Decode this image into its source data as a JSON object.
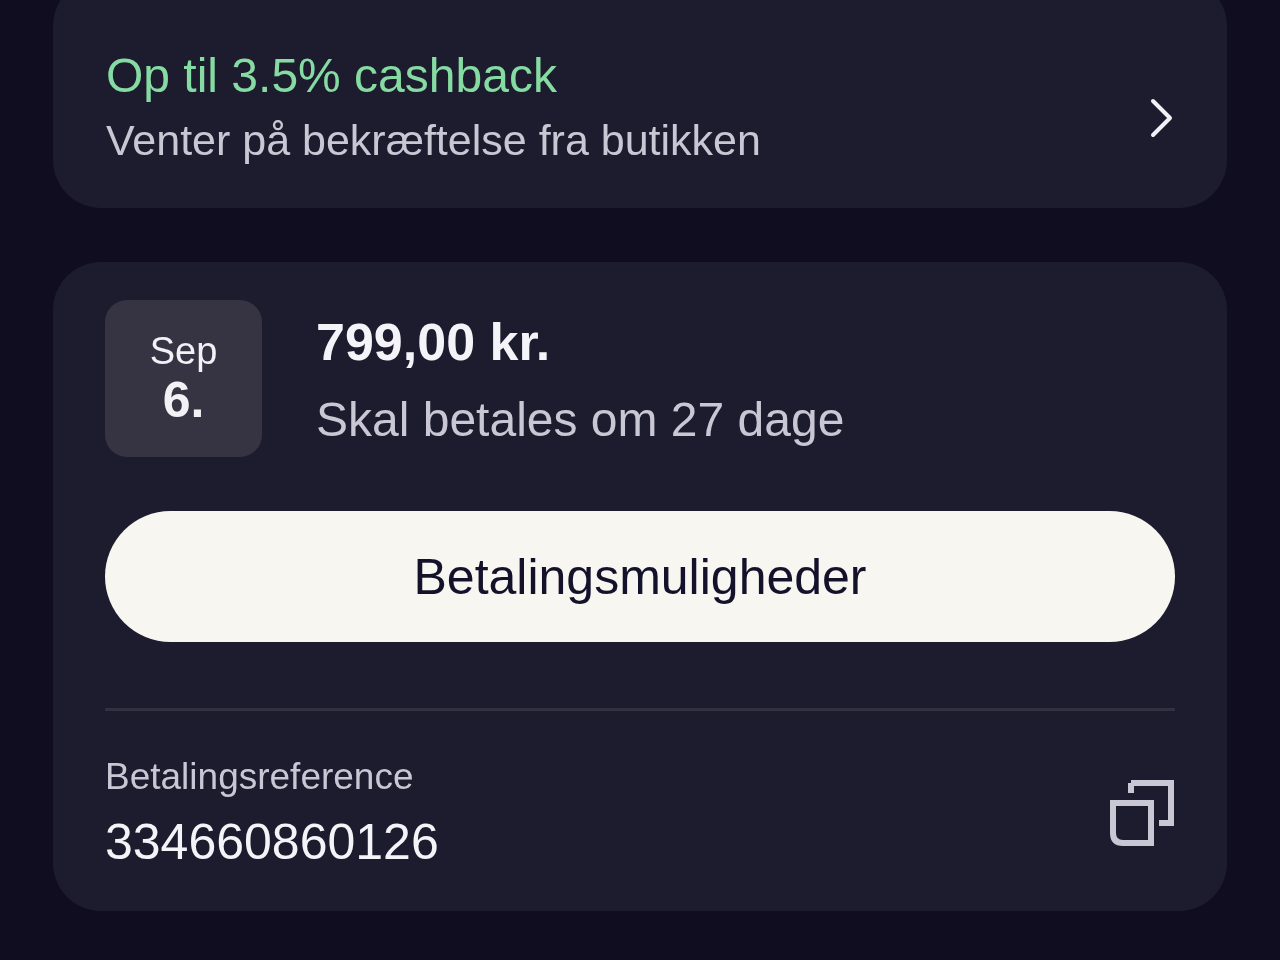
{
  "cashback": {
    "title": "Op til 3.5% cashback",
    "subtitle": "Venter på bekræftelse fra butikken"
  },
  "payment": {
    "month": "Sep",
    "day": "6.",
    "amount": "799,00 kr.",
    "due": "Skal betales om 27 dage",
    "button": "Betalingsmuligheder",
    "reference_label": "Betalingsreference",
    "reference": "334660860126"
  }
}
